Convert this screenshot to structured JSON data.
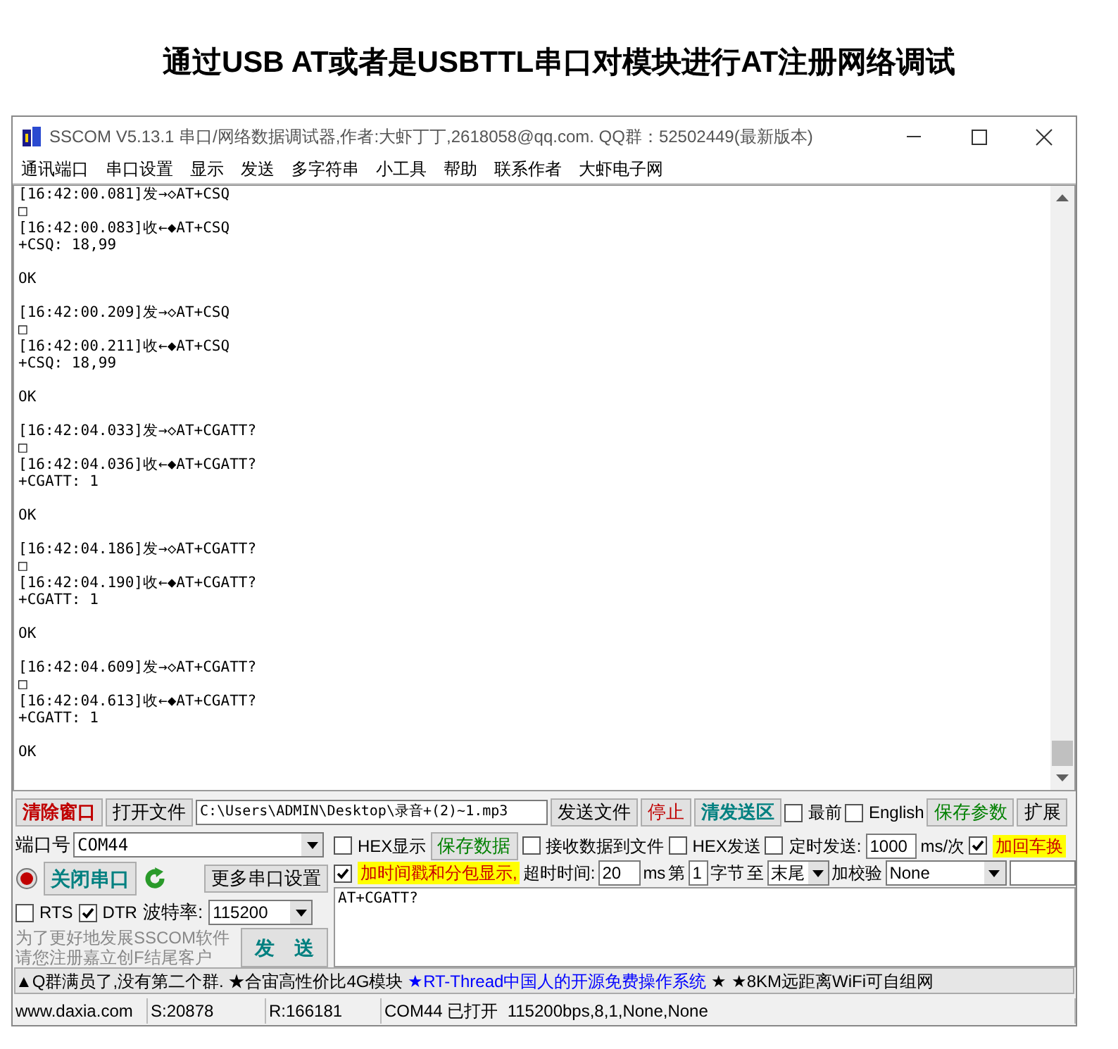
{
  "heading": "通过USB AT或者是USBTTL串口对模块进行AT注册网络调试",
  "window": {
    "title": "SSCOM V5.13.1 串口/网络数据调试器,作者:大虾丁丁,2618058@qq.com. QQ群：52502449(最新版本)"
  },
  "menu": [
    "通讯端口",
    "串口设置",
    "显示",
    "发送",
    "多字符串",
    "小工具",
    "帮助",
    "联系作者",
    "大虾电子网"
  ],
  "log": [
    [
      "[16:42:00.081]发→◇AT+CSQ",
      "□",
      "[16:42:00.083]收←◆AT+CSQ",
      "+CSQ: 18,99"
    ],
    [
      "OK"
    ],
    [
      "[16:42:00.209]发→◇AT+CSQ",
      "□",
      "[16:42:00.211]收←◆AT+CSQ",
      "+CSQ: 18,99"
    ],
    [
      "OK"
    ],
    [
      "[16:42:04.033]发→◇AT+CGATT?",
      "□",
      "[16:42:04.036]收←◆AT+CGATT?",
      "+CGATT: 1"
    ],
    [
      "OK"
    ],
    [
      "[16:42:04.186]发→◇AT+CGATT?",
      "□",
      "[16:42:04.190]收←◆AT+CGATT?",
      "+CGATT: 1"
    ],
    [
      "OK"
    ],
    [
      "[16:42:04.609]发→◇AT+CGATT?",
      "□",
      "[16:42:04.613]收←◆AT+CGATT?",
      "+CGATT: 1"
    ],
    [
      "OK"
    ]
  ],
  "toolbar": {
    "clear_button": "清除窗口",
    "open_file_button": "打开文件",
    "file_path": "C:\\Users\\ADMIN\\Desktop\\录音+(2)~1.mp3",
    "send_file_button": "发送文件",
    "stop_button": "停止",
    "clear_send_button": "清发送区",
    "topmost": {
      "label": "最前",
      "checked": false
    },
    "english": {
      "label": "English",
      "checked": false
    },
    "save_params_button": "保存参数",
    "expand_button": "扩展"
  },
  "port": {
    "label": "端口号",
    "value": "COM44",
    "close_button": "关闭串口",
    "more_settings_button": "更多串口设置",
    "rts": {
      "label": "RTS",
      "checked": false
    },
    "dtr": {
      "label": "DTR",
      "checked": true
    },
    "baud_label": "波特率:",
    "baud": "115200",
    "promo": [
      "为了更好地发展SSCOM软件",
      "请您注册嘉立创F结尾客户"
    ],
    "send_button": "发　送"
  },
  "options": {
    "hex_display": {
      "label": "HEX显示",
      "checked": false,
      "highlighted": false
    },
    "save_data_button": "保存数据",
    "receive_to_file": {
      "label": "接收数据到文件",
      "checked": false,
      "highlighted": false
    },
    "hex_send": {
      "label": "HEX发送",
      "checked": false,
      "highlighted": false
    },
    "timed_send": {
      "label": "定时发送:",
      "checked": false,
      "highlighted": false
    },
    "interval": "1000",
    "interval_unit": "ms/次",
    "add_crlf": {
      "label": "加回车换",
      "checked": true,
      "highlighted": true
    },
    "timestamp": {
      "label": "加时间戳和分包显示,",
      "checked": true,
      "highlighted": true
    },
    "timeout_label": "超时时间:",
    "timeout": "20",
    "timeout_unit": "ms",
    "from_label": "第",
    "from": "1",
    "byte_label": "字节",
    "to_label": "至",
    "to": "末尾",
    "checksum_label": "加校验",
    "checksum": "None"
  },
  "send_text": "AT+CGATT?",
  "ticker": [
    {
      "text": "▲Q群满员了,没有第二个群. ★合宙高性价比4G模块 ",
      "color": "#000000"
    },
    {
      "text": "★RT-Thread中国人的开源免费操作系统",
      "color": "#0000ff"
    },
    {
      "text": " ★ ★8KM远距离WiFi可自组网",
      "color": "#000000"
    }
  ],
  "status_bar": [
    "www.daxia.com",
    "S:20878",
    "R:166181",
    "COM44 已打开  115200bps,8,1,None,None"
  ]
}
